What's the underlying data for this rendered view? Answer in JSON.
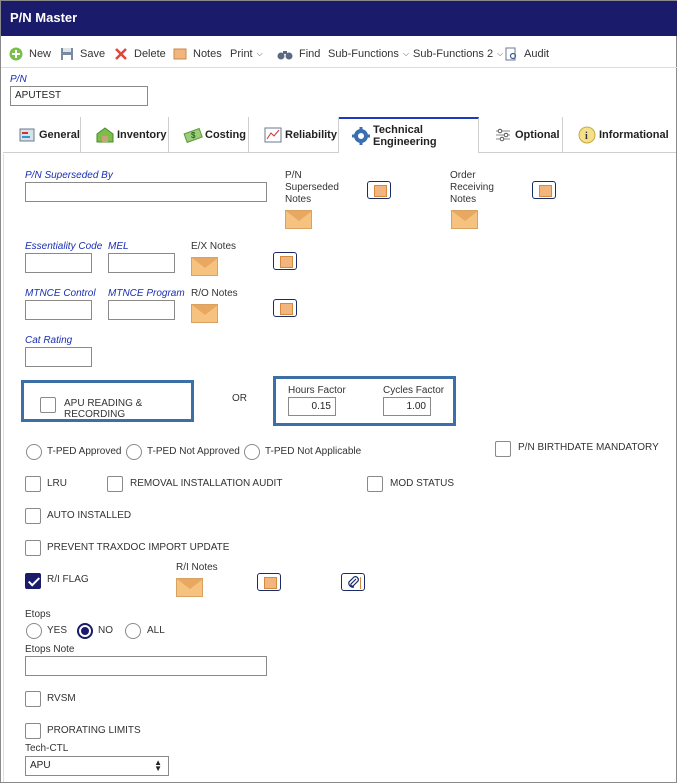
{
  "window": {
    "title": "P/N Master"
  },
  "toolbar": {
    "new": "New",
    "save": "Save",
    "delete": "Delete",
    "notes": "Notes",
    "print": "Print",
    "find": "Find",
    "sub_functions": "Sub-Functions",
    "sub_functions_2": "Sub-Functions 2",
    "audit": "Audit"
  },
  "header": {
    "pn_label": "P/N",
    "pn_value": "APUTEST"
  },
  "tabs": [
    {
      "label": "General"
    },
    {
      "label": "Inventory"
    },
    {
      "label": "Costing"
    },
    {
      "label": "Reliability"
    },
    {
      "label": "Technical Engineering"
    },
    {
      "label": "Optional"
    },
    {
      "label": "Informational"
    }
  ],
  "form": {
    "pn_superseded_by": {
      "label": "P/N Superseded By",
      "value": ""
    },
    "pn_superseded_notes": "P/N\nSuperseded\nNotes",
    "order_receiving_notes": "Order\nReceiving\nNotes",
    "essentiality_code": {
      "label": "Essentiality Code",
      "value": ""
    },
    "mel": {
      "label": "MEL",
      "value": ""
    },
    "ex_notes": "E/X Notes",
    "mtnce_control": {
      "label": "MTNCE Control",
      "value": ""
    },
    "mtnce_program": {
      "label": "MTNCE Program",
      "value": ""
    },
    "ro_notes": "R/O Notes",
    "cat_rating": {
      "label": "Cat Rating",
      "value": ""
    },
    "apu_reading": "APU READING & RECORDING",
    "or_text": "OR",
    "hours_factor": {
      "label": "Hours Factor",
      "value": "0.15"
    },
    "cycles_factor": {
      "label": "Cycles Factor",
      "value": "1.00"
    },
    "tped_approved": "T-PED Approved",
    "tped_not_approved": "T-PED Not Approved",
    "tped_not_applicable": "T-PED Not Applicable",
    "pn_birthdate_mandatory": "P/N BIRTHDATE MANDATORY",
    "lru": "LRU",
    "removal_installation_audit": "REMOVAL INSTALLATION AUDIT",
    "mod_status": "MOD STATUS",
    "auto_installed": "AUTO INSTALLED",
    "prevent_traxdoc": "PREVENT TRAXDOC IMPORT UPDATE",
    "ri_flag": "R/I FLAG",
    "ri_notes": "R/I Notes",
    "etops": {
      "label": "Etops",
      "options": [
        "YES",
        "NO",
        "ALL"
      ],
      "selected": "NO"
    },
    "etops_note": {
      "label": "Etops Note",
      "value": ""
    },
    "rvsm": "RVSM",
    "prorating_limits": "PRORATING LIMITS",
    "tech_ctl": {
      "label": "Tech-CTL",
      "value": "APU"
    }
  },
  "colors": {
    "titlebar": "#1a1b6b",
    "accent_box": "#3c6fa6",
    "label_blue": "#1a2fb3"
  }
}
